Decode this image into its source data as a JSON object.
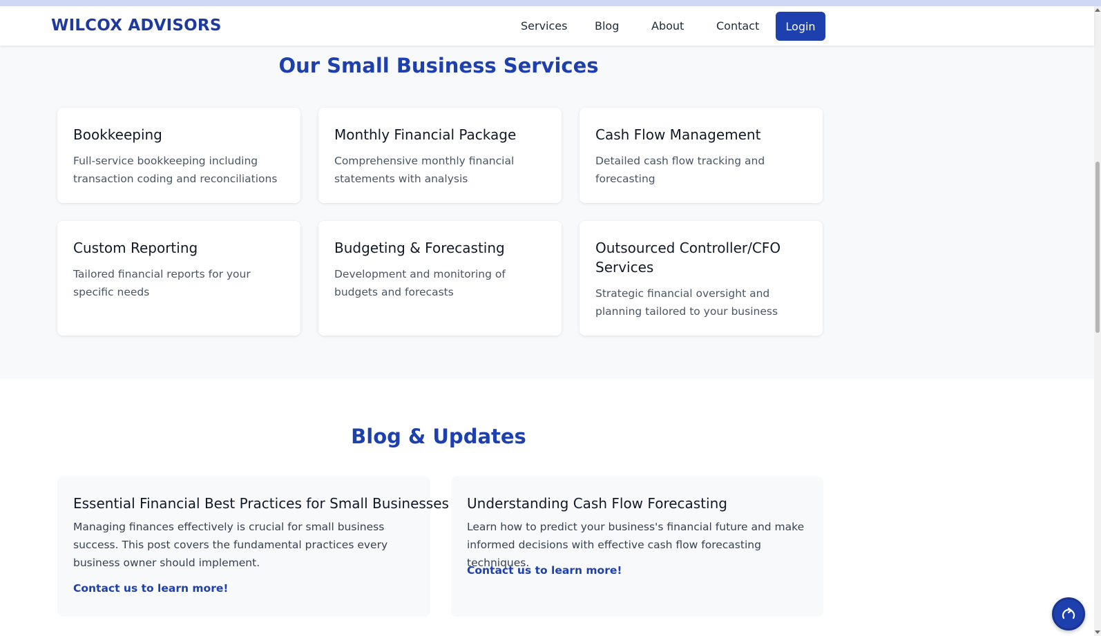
{
  "brand": {
    "name": "WILCOX ADVISORS",
    "color": "#1e3a9f",
    "accent": "#1e40af"
  },
  "nav": {
    "links": [
      "Services",
      "Blog",
      "About",
      "Contact"
    ],
    "login_label": "Login"
  },
  "services": {
    "title": "Our Small Business Services",
    "items": [
      {
        "title": "Bookkeeping",
        "description": "Full-service bookkeeping including transaction coding and reconciliations"
      },
      {
        "title": "Monthly Financial Package",
        "description": "Comprehensive monthly financial statements with analysis"
      },
      {
        "title": "Cash Flow Management",
        "description": "Detailed cash flow tracking and forecasting"
      },
      {
        "title": "Custom Reporting",
        "description": "Tailored financial reports for your specific needs"
      },
      {
        "title": "Budgeting & Forecasting",
        "description": "Development and monitoring of budgets and forecasts"
      },
      {
        "title": "Outsourced Controller/CFO Services",
        "description": "Strategic financial oversight and planning tailored to your business"
      }
    ]
  },
  "blog": {
    "title": "Blog & Updates",
    "posts": [
      {
        "title": "Essential Financial Best Practices for Small Businesses",
        "excerpt": "Managing finances effectively is crucial for small business success. This post covers the fundamental practices every business owner should implement.",
        "link_label": "Contact us to learn more!"
      },
      {
        "title": "Understanding Cash Flow Forecasting",
        "excerpt": "Learn how to predict your business's financial future and make informed decisions with effective cash flow forecasting techniques.",
        "link_label": "Contact us to learn more!"
      }
    ]
  },
  "icons": {
    "fab": "refresh-arrow-icon"
  }
}
